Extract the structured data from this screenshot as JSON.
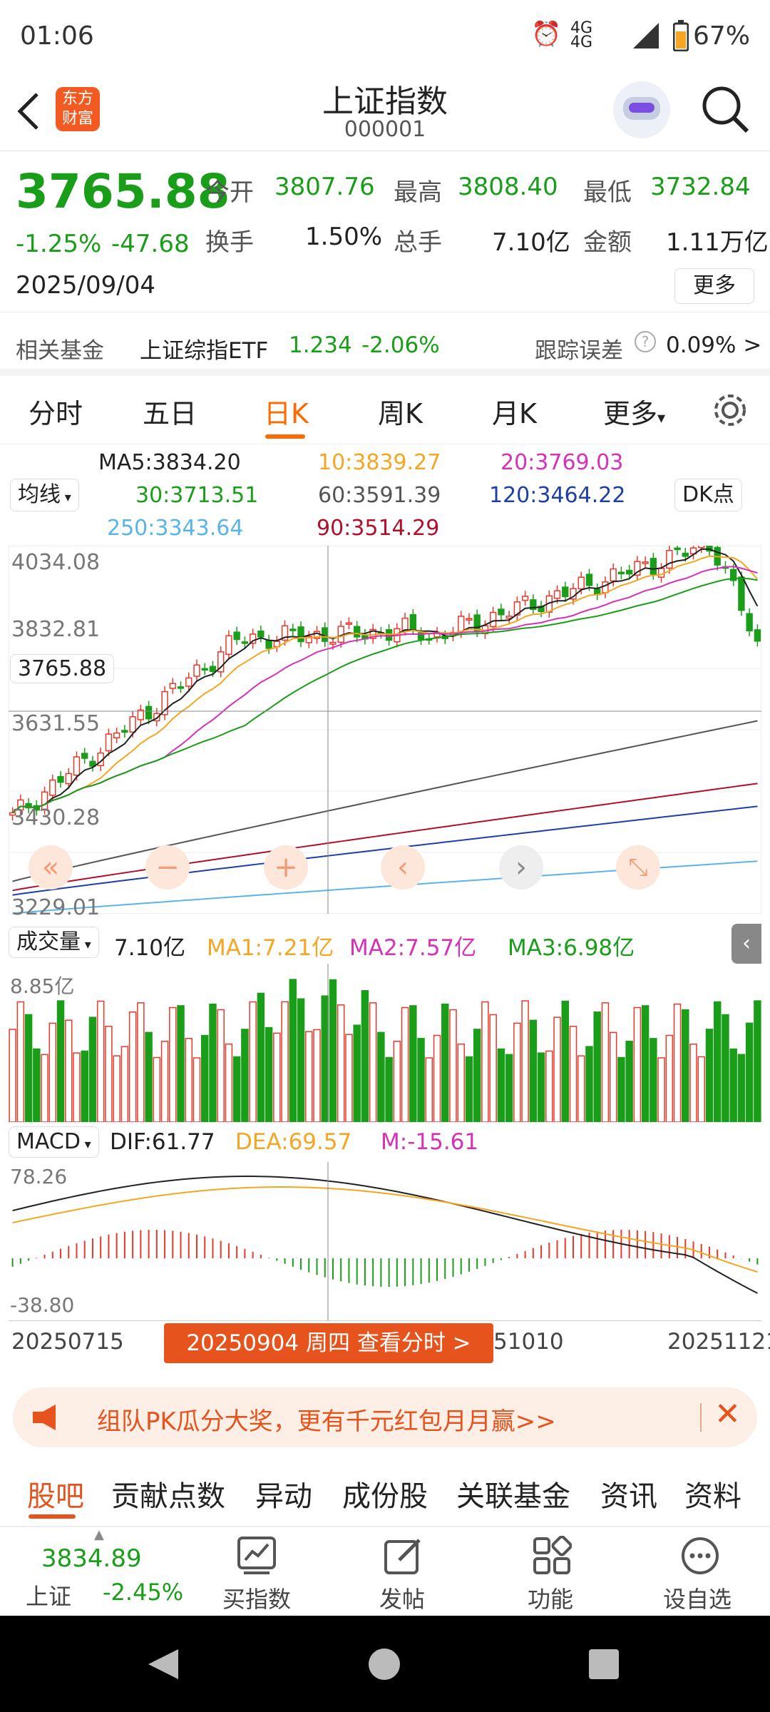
{
  "status": {
    "time": "01:06",
    "network": "4G 4G",
    "battery": "67%"
  },
  "header": {
    "title": "上证指数",
    "code": "000001",
    "logo_line1": "东方",
    "logo_line2": "财富"
  },
  "quote": {
    "price": "3765.88",
    "change_pct": "-1.25%",
    "change": "-47.68",
    "date": "2025/09/04",
    "open_label": "今开",
    "open": "3807.76",
    "high_label": "最高",
    "high": "3808.40",
    "low_label": "最低",
    "low": "3732.84",
    "turnover_label": "换手",
    "turnover": "1.50%",
    "volume_label": "总手",
    "volume": "7.10亿",
    "amount_label": "金额",
    "amount": "1.11万亿",
    "more_label": "更多"
  },
  "fund": {
    "label": "相关基金",
    "name": "上证综指ETF",
    "price": "1.234",
    "pct": "-2.06%",
    "error_label": "跟踪误差",
    "error_value": "0.09% >"
  },
  "tabs": [
    "分时",
    "五日",
    "日K",
    "周K",
    "月K",
    "更多"
  ],
  "ma": {
    "selector": "均线",
    "dk": "DK点",
    "ma5": "MA5:3834.20",
    "ma10": "10:3839.27",
    "ma20": "20:3769.03",
    "ma30": "30:3713.51",
    "ma60": "60:3591.39",
    "ma120": "120:3464.22",
    "ma250": "250:3343.64",
    "ma90": "90:3514.29"
  },
  "price_axis": {
    "top": "4034.08",
    "l2": "3832.81",
    "cursor": "3765.88",
    "l3": "3631.55",
    "l4": "3430.28",
    "bottom": "3229.01"
  },
  "volume": {
    "selector": "成交量",
    "value": "7.10亿",
    "ma1": "MA1:7.21亿",
    "ma2": "MA2:7.57亿",
    "ma3": "MA3:6.98亿",
    "axis_top": "8.85亿"
  },
  "macd": {
    "selector": "MACD",
    "dif": "DIF:61.77",
    "dea": "DEA:69.57",
    "m": "M:-15.61",
    "axis_top": "78.26",
    "axis_bottom": "-38.80"
  },
  "dates": {
    "start": "20250715",
    "tooltip": "20250904 周四 查看分时 >",
    "mid": "51010",
    "end": "20251121"
  },
  "banner": {
    "text": "组队PK瓜分大奖，更有千元红包月月赢>>"
  },
  "subtabs": [
    "股吧",
    "贡献点数",
    "异动",
    "成份股",
    "关联基金",
    "资讯",
    "资料"
  ],
  "bottom": {
    "index_value": "3834.89",
    "index_name": "上证",
    "index_pct": "-2.45%",
    "buy": "买指数",
    "post": "发帖",
    "func": "功能",
    "watch": "设自选"
  },
  "colors": {
    "up": "#e8392b",
    "down": "#1a9e1a",
    "accent": "#ff6a00",
    "ma10": "#f5a623",
    "ma20": "#d631b8",
    "ma30": "#1a9e1a",
    "ma60": "#555555",
    "ma120": "#1f3fa8",
    "ma250": "#5ab4ea",
    "ma90": "#b0102a"
  }
}
